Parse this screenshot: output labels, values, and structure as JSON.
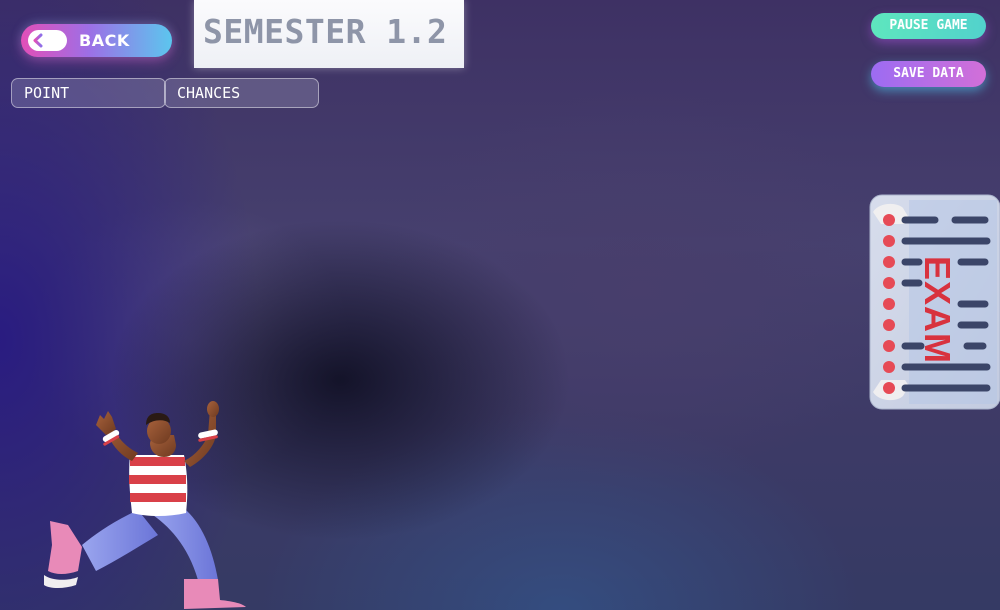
{
  "hud": {
    "back_label": "BACK",
    "point_label": "POINT",
    "chances_label": "CHANCES"
  },
  "level": {
    "title": "SEMESTER 1.2"
  },
  "controls": {
    "pause_label": "PAUSE GAME",
    "save_label": "SAVE DATA"
  },
  "exam_card": {
    "label": "EXAM",
    "label_color": "#d8323e"
  },
  "colors": {
    "back_gradient": [
      "#e24fb8",
      "#5cc6ee"
    ],
    "pause_color": "#5ee6be",
    "save_gradient": [
      "#9c6cf2",
      "#d26fd8"
    ]
  },
  "icons": {
    "back": "arrow-left-icon"
  }
}
